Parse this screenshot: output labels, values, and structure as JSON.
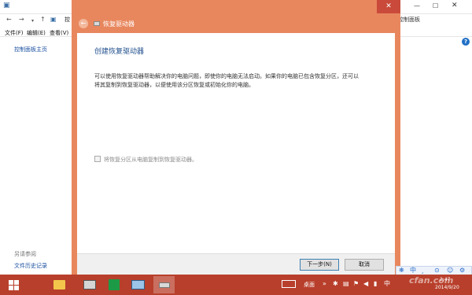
{
  "background_window": {
    "address_left": "控",
    "address_right": "控制面板",
    "menu": [
      "文件(F)",
      "编辑(E)",
      "查看(V)"
    ],
    "help_symbol": "?",
    "sidebar_home": "控制面板主页",
    "see_also": "另请参阅",
    "file_history": "文件历史记录",
    "window_buttons": [
      "—",
      "☐",
      "✕"
    ]
  },
  "wizard": {
    "title": "恢复驱动器",
    "heading": "创建恢复驱动器",
    "description": "可以使用恢复驱动器帮助解决你的电脑问题，即使你的电脑无法启动。如果你的电脑已包含恢复分区，还可以将其复制到恢复驱动器，以便使用该分区恢复或初始化你的电脑。",
    "checkbox_label": "将恢复分区从电脑复制到恢复驱动器。",
    "checkbox_checked": false,
    "next_button": "下一步(N)",
    "cancel_button": "取消",
    "close_symbol": "✕",
    "back_symbol": "←"
  },
  "taskbar": {
    "desktop_label": "桌面",
    "clock_time": "2:47",
    "clock_date": "2014/9/20",
    "apps": [
      "start-icon",
      "file-explorer-icon",
      "store-icon",
      "control-panel-icon",
      "recovery-drive-icon"
    ]
  },
  "ime_toolbar": {
    "items": [
      "中",
      "¸",
      "⊙",
      "☺",
      "⚙"
    ]
  },
  "watermark": "cfan.com",
  "colors": {
    "wizard_frame": "#e8875e",
    "taskbar": "#b83f2b",
    "heading": "#1f4e8c",
    "close_button": "#c94a3a"
  }
}
